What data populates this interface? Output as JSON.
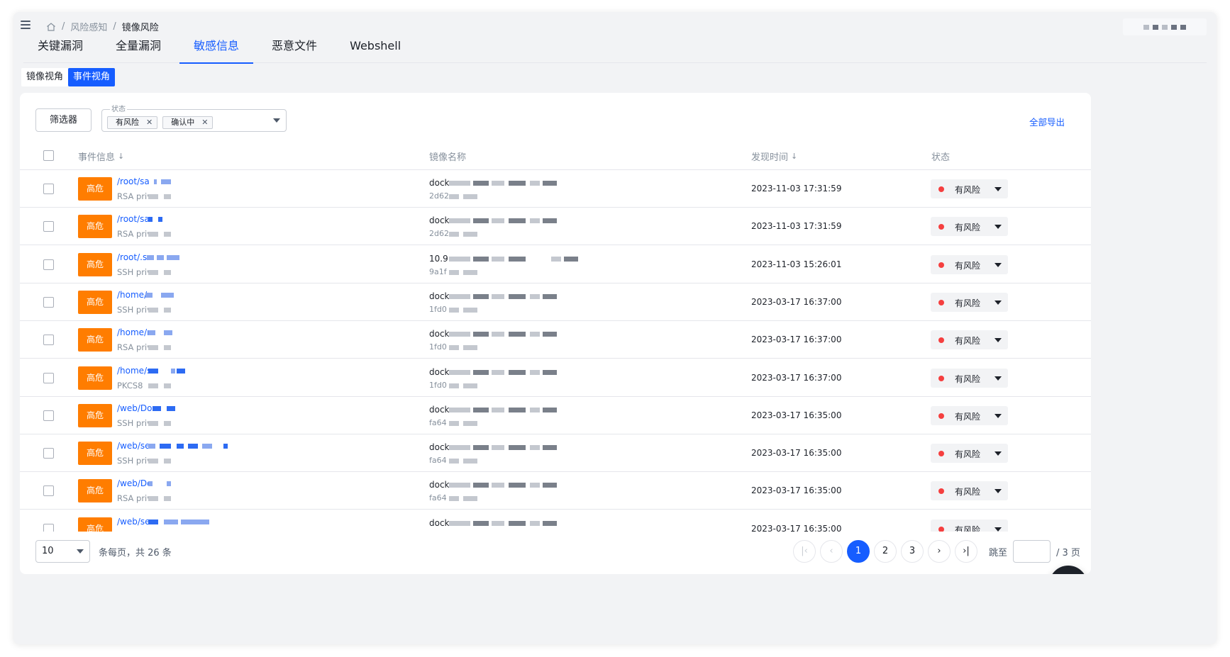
{
  "breadcrumb": {
    "items": [
      "风险感知",
      "镜像风险"
    ]
  },
  "tabs": [
    {
      "label": "关键漏洞"
    },
    {
      "label": "全量漏洞"
    },
    {
      "label": "敏感信息",
      "active": true
    },
    {
      "label": "恶意文件"
    },
    {
      "label": "Webshell"
    }
  ],
  "view_switch": {
    "image_view": "镜像视角",
    "event_view": "事件视角",
    "active": "事件视角"
  },
  "toolbar": {
    "filter_button": "筛选器",
    "status_label": "状态",
    "status_tags": [
      "有风险",
      "确认中"
    ],
    "export_label": "全部导出"
  },
  "table": {
    "columns": {
      "event": "事件信息",
      "image": "镜像名称",
      "time": "发现时间",
      "status": "状态"
    },
    "rows": [
      {
        "severity": "高危",
        "path": "/root/sa",
        "type": "RSA priv",
        "image": "dock",
        "image_id": "2d62",
        "time": "2023-11-03 17:31:59",
        "status": "有风险"
      },
      {
        "severity": "高危",
        "path": "/root/sa",
        "type": "RSA priv",
        "image": "dock",
        "image_id": "2d62",
        "time": "2023-11-03 17:31:59",
        "status": "有风险"
      },
      {
        "severity": "高危",
        "path": "/root/.ss",
        "type": "SSH priv",
        "image": "10.9",
        "image_id": "9a1f",
        "time": "2023-11-03 15:26:01",
        "status": "有风险"
      },
      {
        "severity": "高危",
        "path": "/home/s",
        "type": "SSH priv",
        "image": "dock",
        "image_id": "1fd0",
        "time": "2023-03-17 16:37:00",
        "status": "有风险"
      },
      {
        "severity": "高危",
        "path": "/home/r",
        "type": "RSA priv",
        "image": "dock",
        "image_id": "1fd0",
        "time": "2023-03-17 16:37:00",
        "status": "有风险"
      },
      {
        "severity": "高危",
        "path": "/home/s",
        "type": "PKCS8",
        "image": "dock",
        "image_id": "1fd0",
        "time": "2023-03-17 16:37:00",
        "status": "有风险"
      },
      {
        "severity": "高危",
        "path": "/web/Do",
        "type": "SSH priv",
        "image": "dock",
        "image_id": "fa64",
        "time": "2023-03-17 16:35:00",
        "status": "有风险"
      },
      {
        "severity": "高危",
        "path": "/web/se",
        "type": "SSH priv",
        "image": "dock",
        "image_id": "fa64",
        "time": "2023-03-17 16:35:00",
        "status": "有风险"
      },
      {
        "severity": "高危",
        "path": "/web/Do",
        "type": "RSA priv",
        "image": "dock",
        "image_id": "fa64",
        "time": "2023-03-17 16:35:00",
        "status": "有风险"
      },
      {
        "severity": "高危",
        "path": "/web/se",
        "type": "",
        "image": "dock",
        "image_id": "",
        "time": "2023-03-17 16:35:00",
        "status": "有风险"
      }
    ]
  },
  "pagination": {
    "page_size": "10",
    "summary": "条每页，共 26 条",
    "pages": [
      "1",
      "2",
      "3"
    ],
    "current": "1",
    "jump_label": "跳至",
    "total_pages": "/ 3 页"
  },
  "colors": {
    "accent": "#165dff",
    "severity_high": "#ff7d00",
    "risk_dot": "#f53f3f"
  },
  "icons": [
    "menu-icon",
    "home-icon",
    "close-icon",
    "chevron-down-icon",
    "sort-down-icon",
    "first-page-icon",
    "prev-page-icon",
    "next-page-icon",
    "last-page-icon",
    "document-icon"
  ]
}
